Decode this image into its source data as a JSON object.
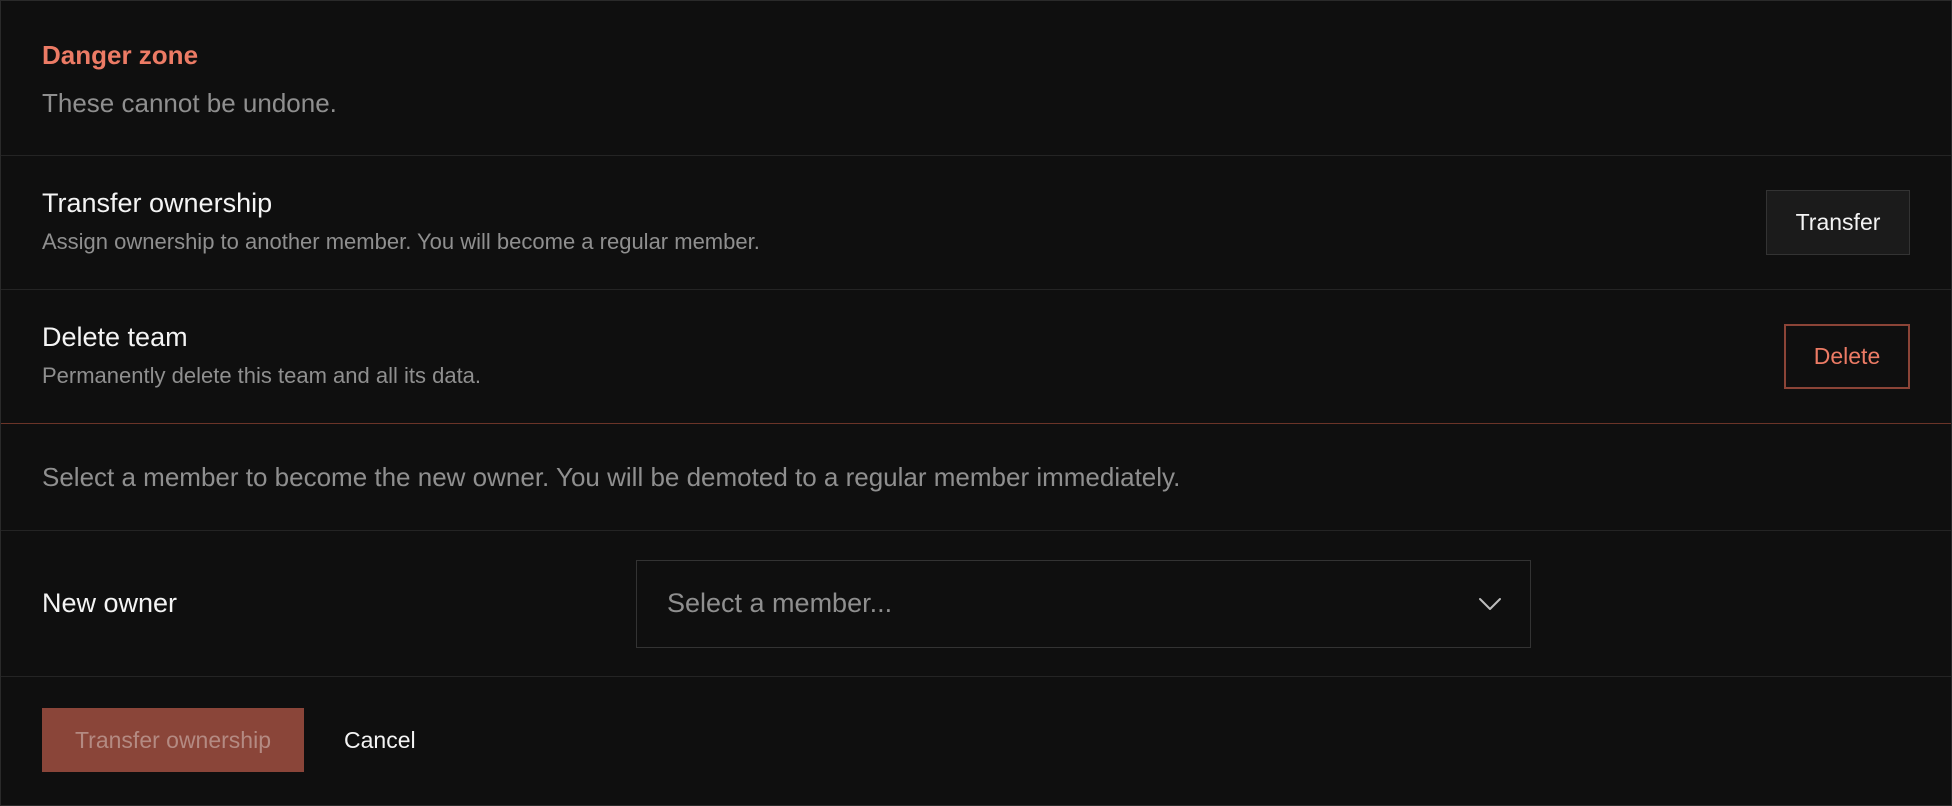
{
  "danger_zone": {
    "title": "Danger zone",
    "subtitle": "These cannot be undone."
  },
  "transfer_row": {
    "name": "Transfer ownership",
    "description": "Assign ownership to another member. You will become a regular member.",
    "button_label": "Transfer"
  },
  "delete_row": {
    "name": "Delete team",
    "description": "Permanently delete this team and all its data.",
    "button_label": "Delete"
  },
  "transfer_form": {
    "notice": "Select a member to become the new owner. You will be demoted to a regular member immediately.",
    "new_owner_label": "New owner",
    "select_placeholder": "Select a member...",
    "select_icon": "chevron-down-icon",
    "confirm_label": "Transfer ownership",
    "cancel_label": "Cancel"
  },
  "colors": {
    "background": "#0f0f0f",
    "danger_accent": "#ec7b65",
    "danger_fill_disabled": "#8a4539",
    "muted_text": "#8f8f8f",
    "border": "#242424"
  }
}
